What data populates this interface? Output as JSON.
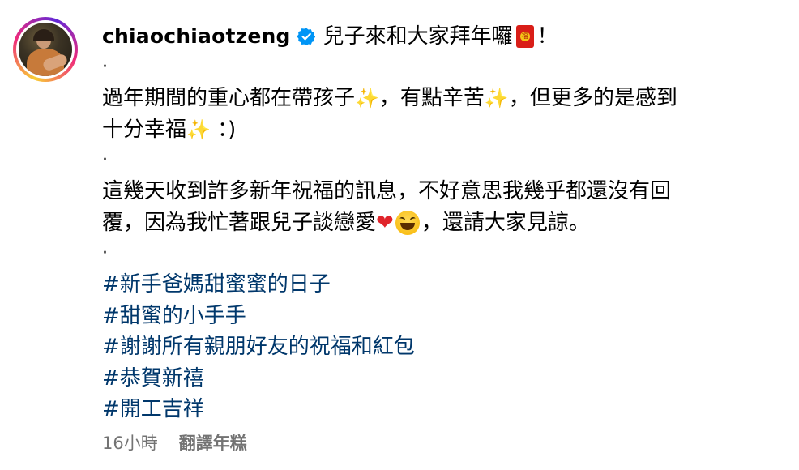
{
  "post": {
    "username": "chiaochiaotzeng",
    "headline_text": "兒子來和大家拜年囉",
    "headline_end": "！",
    "dot": "·",
    "para1_a": "過年期間的重心都在帶孩子",
    "para1_b": "，有點辛苦",
    "para1_c": "，但更多的是感到",
    "para1_d": "十分幸福",
    "para1_e": "：)",
    "para2_a": "這幾天收到許多新年祝福的訊息，不好意思我幾乎都還沒有回",
    "para2_b": "覆，因為我忙著跟兒子談戀愛",
    "para2_c": "，還請大家見諒。",
    "hashtags": [
      "#新手爸媽甜蜜蜜的日子",
      "#甜蜜的小手手",
      "#謝謝所有親朋好友的祝福和紅包",
      "#恭賀新禧",
      "#開工吉祥"
    ],
    "timestamp": "16小時",
    "translate_label": "翻譯年糕"
  },
  "icons": {
    "verified": "verified-badge-icon",
    "sparkles": "sparkles-emoji",
    "red_envelope": "red-envelope-emoji",
    "heart": "red-heart-emoji",
    "grin": "grinning-squinting-face-emoji"
  },
  "colors": {
    "hashtag": "#00376b",
    "verified": "#0095f6",
    "meta": "#737373"
  }
}
